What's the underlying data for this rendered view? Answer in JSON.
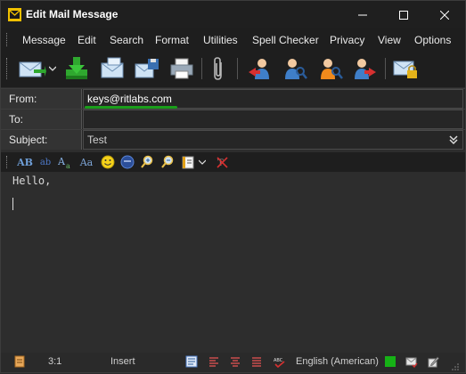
{
  "window": {
    "title": "Edit Mail Message"
  },
  "menu": {
    "items": [
      "Message",
      "Edit",
      "Search",
      "Format",
      "Utilities",
      "Spell Checker",
      "Privacy",
      "View",
      "Options"
    ]
  },
  "toolbar": {
    "buttons": [
      "send-mail",
      "save-draft",
      "send-later",
      "save-as",
      "print",
      "attach",
      "reply-all",
      "find-user",
      "find-group",
      "forward",
      "encrypt"
    ]
  },
  "headers": {
    "from_label": "From:",
    "from_value": "keys@ritlabs.com",
    "to_label": "To:",
    "to_value": "",
    "subject_label": "Subject:",
    "subject_value": "Test"
  },
  "format_toolbar": {
    "font_label": "AB",
    "font_small": "ab",
    "size_label": "Aa",
    "case_label": "Aa"
  },
  "editor": {
    "body": "Hello,"
  },
  "status": {
    "position": "3:1",
    "mode": "Insert",
    "language": "English (American)"
  },
  "colors": {
    "accent": "#1a9e1a",
    "highlight_underline": "#1a9e1a",
    "status_green": "#16b116"
  }
}
